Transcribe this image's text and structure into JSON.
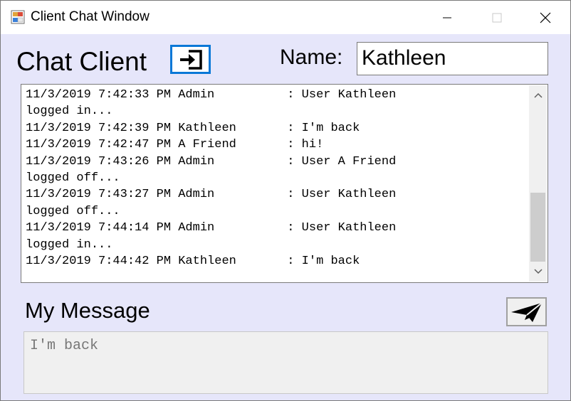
{
  "window": {
    "title": "Client Chat Window"
  },
  "header": {
    "heading": "Chat Client",
    "login_icon": "sign-in-icon",
    "name_label": "Name:",
    "name_value": "Kathleen"
  },
  "log": {
    "lines": [
      "11/3/2019 7:42:33 PM Admin          : User Kathleen",
      "logged in...",
      "11/3/2019 7:42:39 PM Kathleen       : I'm back",
      "11/3/2019 7:42:47 PM A Friend       : hi!",
      "11/3/2019 7:43:26 PM Admin          : User A Friend",
      "logged off...",
      "11/3/2019 7:43:27 PM Admin          : User Kathleen",
      "logged off...",
      "11/3/2019 7:44:14 PM Admin          : User Kathleen",
      "logged in...",
      "11/3/2019 7:44:42 PM Kathleen       : I'm back"
    ]
  },
  "compose": {
    "label": "My Message",
    "message_value": "I'm back",
    "send_icon": "paper-plane-icon"
  },
  "colors": {
    "background": "#e6e6fa",
    "accent": "#0a78d7"
  }
}
